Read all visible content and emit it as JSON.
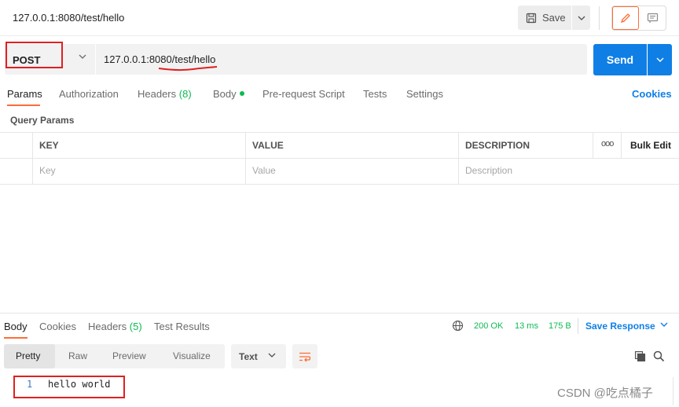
{
  "header": {
    "request_title": "127.0.0.1:8080/test/hello",
    "save_label": "Save"
  },
  "request": {
    "method": "POST",
    "url": "127.0.0.1:8080/test/hello",
    "send_label": "Send"
  },
  "request_tabs": {
    "params": "Params",
    "authorization": "Authorization",
    "headers_label": "Headers",
    "headers_count": "(8)",
    "body": "Body",
    "pre_request": "Pre-request Script",
    "tests": "Tests",
    "settings": "Settings",
    "cookies": "Cookies"
  },
  "params": {
    "section_title": "Query Params",
    "columns": {
      "key": "KEY",
      "value": "VALUE",
      "description": "DESCRIPTION"
    },
    "more": "ooo",
    "bulk_edit": "Bulk Edit",
    "placeholders": {
      "key": "Key",
      "value": "Value",
      "description": "Description"
    }
  },
  "response": {
    "tabs": {
      "body": "Body",
      "cookies": "Cookies",
      "headers_label": "Headers",
      "headers_count": "(5)",
      "test_results": "Test Results"
    },
    "status": "200 OK",
    "time": "13 ms",
    "size": "175 B",
    "save_response": "Save Response",
    "views": {
      "pretty": "Pretty",
      "raw": "Raw",
      "preview": "Preview",
      "visualize": "Visualize"
    },
    "format": "Text",
    "lines": [
      {
        "number": "1",
        "text": "hello world"
      }
    ]
  },
  "watermark": "CSDN @吃点橘子",
  "colors": {
    "accent": "#ff6c37",
    "primary": "#0f7fe6",
    "success": "#0cbb52",
    "highlight": "#e02020"
  }
}
